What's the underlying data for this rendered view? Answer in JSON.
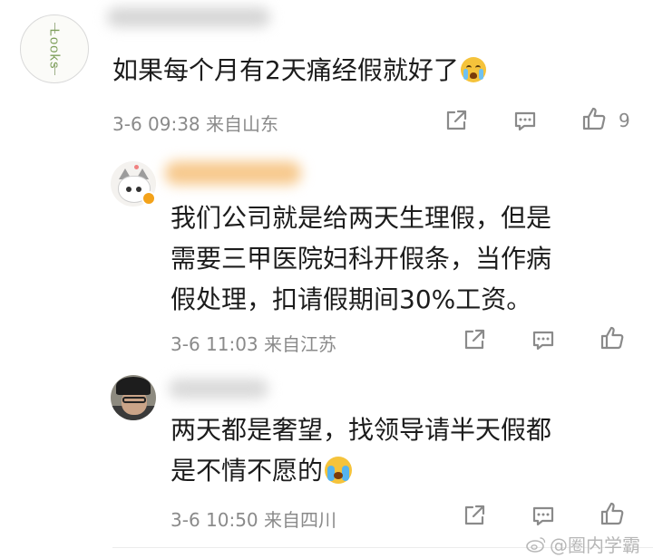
{
  "comment": {
    "avatar_text": "Looks",
    "text": "如果每个月有2天痛经假就好了",
    "emoji": "crying-face-icon",
    "meta": "3-6 09:38  来自山东",
    "like_count": "9"
  },
  "replies": [
    {
      "text": "我们公司就是给两天生理假，但是需要三甲医院妇科开假条，当作病假处理，扣请假期间30%工资。",
      "lines": [
        "我们公司就是给两天生理假，但是",
        "需要三甲医院妇科开假条，当作病",
        "假处理，扣请假期间30%工资。"
      ],
      "meta": "3-6 11:03  来自江苏"
    },
    {
      "text": "两天都是奢望，找领导请半天假都是不情不愿的",
      "lines": [
        "两天都是奢望，找领导请半天假都",
        "是不情不愿的"
      ],
      "emoji": "loudly-crying-face-icon",
      "meta": "3-6 10:50  来自四川"
    }
  ],
  "watermark": "@圈内学霸",
  "colors": {
    "text": "#1c1c1c",
    "meta": "#8a8a8a",
    "icon": "#8a8a8a",
    "looks_green": "#7fa05c"
  }
}
